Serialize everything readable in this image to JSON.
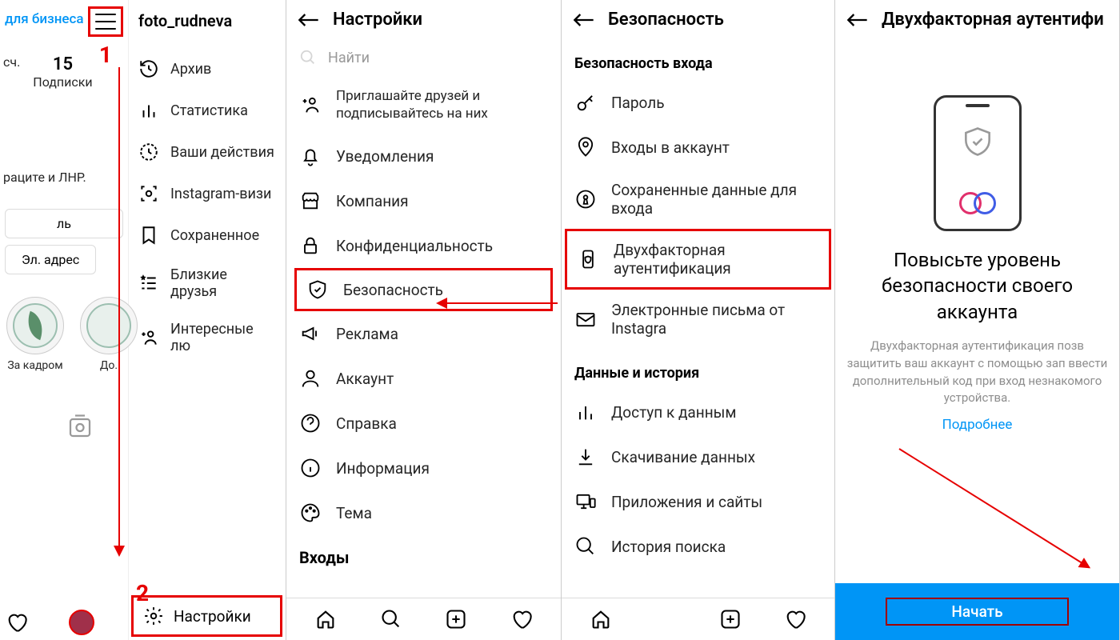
{
  "panel1": {
    "biz_link": "для бизнеса",
    "step1": "1",
    "step2": "2",
    "stats": {
      "num": "15",
      "num_lbl_partial": "сч.",
      "lbl": "Подписки"
    },
    "partial_text": "раците и ЛНР.",
    "btn1": "ль",
    "btn2": "Эл. адрес",
    "highlight1": "За кадром",
    "highlight2": "До.",
    "username": "foto_rudneva",
    "menu": {
      "archive": "Архив",
      "insights": "Статистика",
      "activity": "Ваши действия",
      "nametag": "Instagram-визи",
      "saved": "Сохраненное",
      "close_friends": "Близкие друзья",
      "discover": "Интересные лю",
      "settings": "Настройки"
    }
  },
  "panel2": {
    "title": "Настройки",
    "search_placeholder": "Найти",
    "items": {
      "follow": "Приглашайте друзей и подписывайтесь на них",
      "notifications": "Уведомления",
      "business": "Компания",
      "privacy": "Конфиденциальность",
      "security": "Безопасность",
      "ads": "Реклама",
      "account": "Аккаунт",
      "help": "Справка",
      "about": "Информация",
      "theme": "Тема"
    },
    "logins_header": "Входы"
  },
  "panel3": {
    "title": "Безопасность",
    "login_security_header": "Безопасность входа",
    "items": {
      "password": "Пароль",
      "login_activity": "Входы в аккаунт",
      "saved_login": "Сохраненные данные для входа",
      "two_factor": "Двухфакторная аутентификация",
      "emails": "Электронные письма от Instagra"
    },
    "data_history_header": "Данные и история",
    "data_items": {
      "access_data": "Доступ к данным",
      "download_data": "Скачивание данных",
      "apps_websites": "Приложения и сайты",
      "search_history": "История поиска"
    }
  },
  "panel4": {
    "title": "Двухфакторная аутентифи",
    "heading": "Повысьте уровень безопасности своего аккаунта",
    "description": "Двухфакторная аутентификация позв защитить ваш аккаунт с помощью зап ввести дополнительный код при вход незнакомого устройства.",
    "learn_more": "Подробнее",
    "cta": "Начать"
  }
}
